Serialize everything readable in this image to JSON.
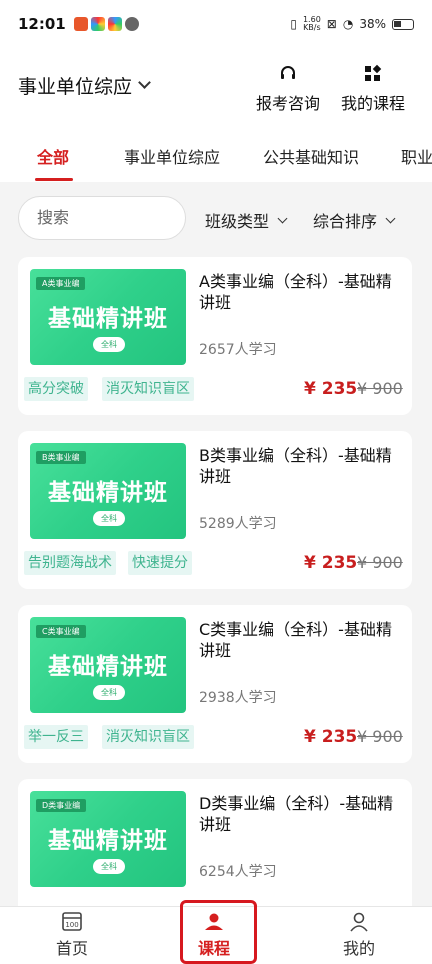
{
  "status": {
    "time": "12:01",
    "speed_top": "1.60",
    "speed_bottom": "KB/s",
    "battery": "38%"
  },
  "header": {
    "title": "事业单位综应",
    "consult": "报考咨询",
    "my_courses": "我的课程"
  },
  "tabs": [
    "全部",
    "事业单位综应",
    "公共基础知识",
    "职业"
  ],
  "filter": {
    "search_placeholder": "搜索",
    "class_type": "班级类型",
    "sort": "综合排序"
  },
  "courses": [
    {
      "thumb_tag": "A类事业编",
      "thumb_title": "基础精讲班",
      "thumb_pill": "全科",
      "title": "A类事业编（全科）-基础精讲班",
      "count": "2657人学习",
      "chips": [
        "高分突破",
        "消灭知识盲区"
      ],
      "price": "¥ 235",
      "original": "¥ 900"
    },
    {
      "thumb_tag": "B类事业编",
      "thumb_title": "基础精讲班",
      "thumb_pill": "全科",
      "title": "B类事业编（全科）-基础精讲班",
      "count": "5289人学习",
      "chips": [
        "告别题海战术",
        "快速提分"
      ],
      "price": "¥ 235",
      "original": "¥ 900"
    },
    {
      "thumb_tag": "C类事业编",
      "thumb_title": "基础精讲班",
      "thumb_pill": "全科",
      "title": "C类事业编（全科）-基础精讲班",
      "count": "2938人学习",
      "chips": [
        "举一反三",
        "消灭知识盲区"
      ],
      "price": "¥ 235",
      "original": "¥ 900"
    },
    {
      "thumb_tag": "D类事业编",
      "thumb_title": "基础精讲班",
      "thumb_pill": "全科",
      "title": "D类事业编（全科）-基础精讲班",
      "count": "6254人学习",
      "chips": [],
      "price": "",
      "original": ""
    }
  ],
  "bottom_nav": {
    "home": "首页",
    "courses": "课程",
    "mine": "我的"
  },
  "colors": {
    "accent": "#d51f1f",
    "thumb_green": "#2fd08a",
    "chip_bg": "#e6f6f3",
    "chip_text": "#3fb48f"
  }
}
